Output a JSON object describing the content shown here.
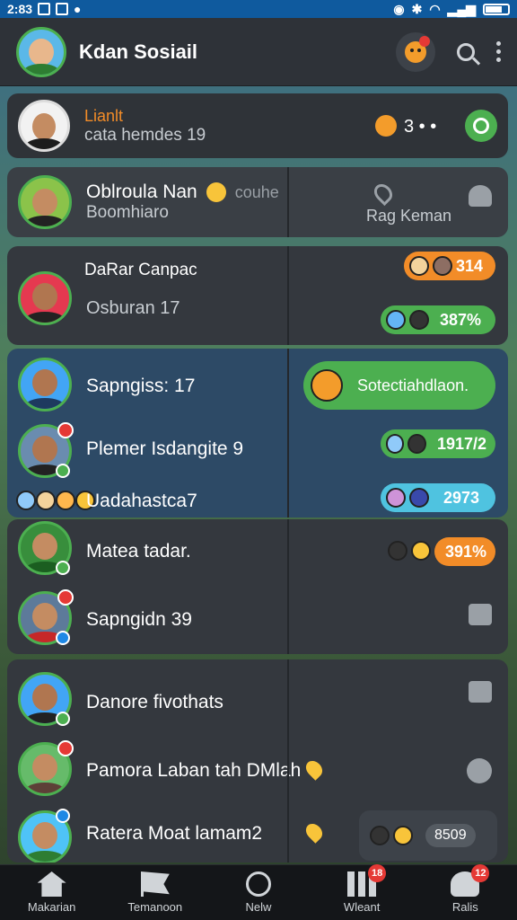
{
  "status_bar": {
    "time": "2:83"
  },
  "header": {
    "title": "Kdan Sosiail"
  },
  "rows": {
    "r0": {
      "name": "Lianlt",
      "sub": "cata hemdes 19",
      "count": "3 • •"
    },
    "r1": {
      "name": "Oblroula Nan",
      "name_suffix": "couhe",
      "sub": "Boomhiaro",
      "side_label": "Rag Keman"
    },
    "r2": {
      "name": "DaRar Canpac",
      "sub": "Osburan 17",
      "pill1": "314",
      "pill2": "387%"
    },
    "r3": {
      "name": "Sapngiss: 17",
      "bubble": "Sotectiahdlaon."
    },
    "r4": {
      "name": "Plemer Isdangite 9",
      "pill": "1917/2"
    },
    "r5": {
      "name": "Uadahastca7",
      "pill": "2973"
    },
    "r6": {
      "name": "Matea tadar.",
      "pill": "391%"
    },
    "r7": {
      "name": "Sapngidn 39"
    },
    "r8": {
      "name": "Danore fivothats"
    },
    "r9": {
      "name": "Pamora Laban tah DMlah"
    },
    "r10": {
      "name": "Ratera Moat lamam2",
      "pill": "8509"
    }
  },
  "nav": [
    {
      "label": "Makarian",
      "icon": "home-icon"
    },
    {
      "label": "Temanoon",
      "icon": "flag-icon"
    },
    {
      "label": "Nelw",
      "icon": "circle-icon"
    },
    {
      "label": "Wleant",
      "icon": "grid-icon",
      "badge": "18"
    },
    {
      "label": "Ralis",
      "icon": "user-icon",
      "badge": "12"
    }
  ],
  "colors": {
    "accent_green": "#4caf50",
    "accent_orange": "#f28c28",
    "accent_cyan": "#4fc3e0",
    "status_bar": "#0f5a9e"
  }
}
